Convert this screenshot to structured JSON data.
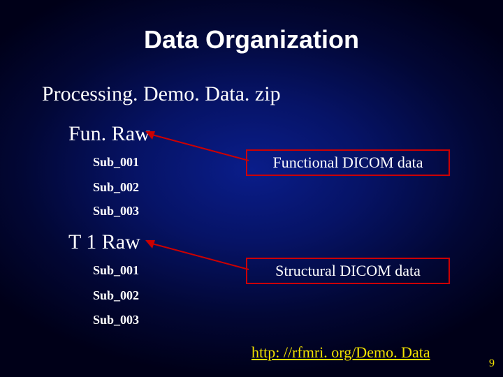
{
  "title": "Data Organization",
  "archive_name": "Processing. Demo. Data. zip",
  "folders": {
    "fun": {
      "label": "Fun. Raw",
      "subs": [
        "Sub_001",
        "Sub_002",
        "Sub_003"
      ],
      "callout": "Functional DICOM data"
    },
    "t1": {
      "label": "T 1 Raw",
      "subs": [
        "Sub_001",
        "Sub_002",
        "Sub_003"
      ],
      "callout": "Structural DICOM data"
    }
  },
  "link_text": "http: //rfmri. org/Demo. Data",
  "page_number": "9",
  "colors": {
    "accent_red": "#cc0000",
    "link_yellow": "#f2e200"
  }
}
